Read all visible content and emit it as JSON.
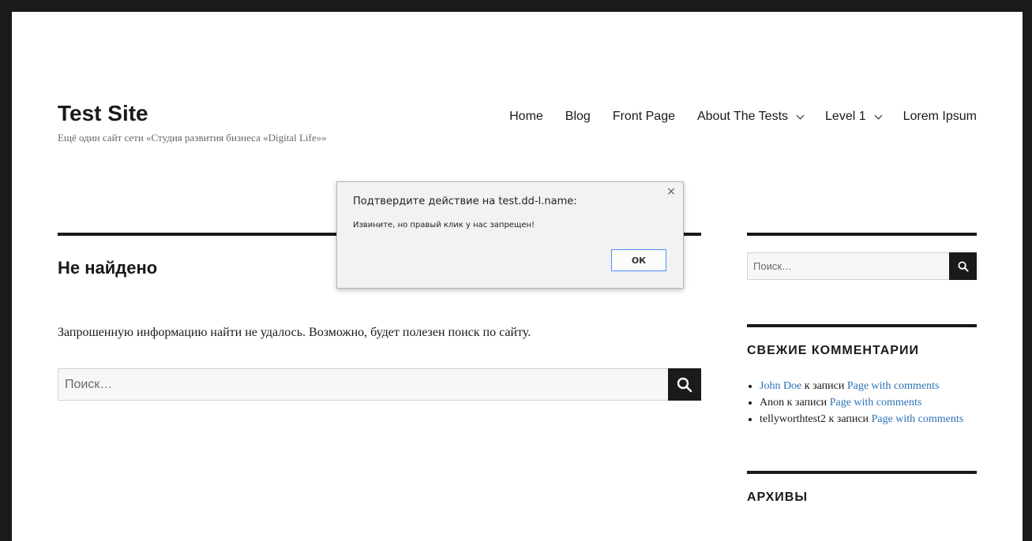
{
  "site": {
    "title": "Test Site",
    "description": "Ещё один сайт сети «Студия развития бизнеса «Digital Life»»"
  },
  "nav": {
    "items": [
      "Home",
      "Blog",
      "Front Page",
      "About The Tests",
      "Level 1",
      "Lorem Ipsum"
    ]
  },
  "main": {
    "heading": "Не найдено",
    "text": "Запрошенную информацию найти не удалось. Возможно, будет полезен поиск по сайту.",
    "search_placeholder": "Поиск…"
  },
  "sidebar": {
    "search_placeholder": "Поиск…",
    "recent_comments_title": "СВЕЖИЕ КОММЕНТАРИИ",
    "comments": [
      {
        "author": "John Doe",
        "joiner": " к записи ",
        "post": "Page with comments"
      },
      {
        "author": "Anon",
        "joiner": " к записи ",
        "post": "Page with comments"
      },
      {
        "author": "tellyworthtest2",
        "joiner": " к записи ",
        "post": "Page with comments"
      }
    ],
    "archives_title": "АРХИВЫ"
  },
  "dialog": {
    "title": "Подтвердите действие на test.dd-l.name:",
    "message": "Извините, но правый клик у нас запрещен!",
    "close": "×",
    "ok_label": "ОК"
  },
  "colors": {
    "accent_link": "#2b72b6",
    "dark": "#1a1a1a",
    "ok_border": "#4d90fe"
  }
}
